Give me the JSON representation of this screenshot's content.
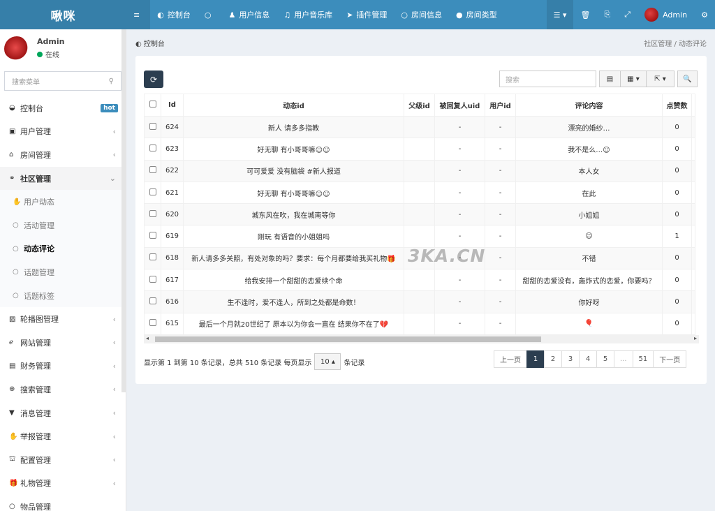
{
  "header": {
    "logo": "啾咪",
    "nav": [
      {
        "icon": "≡",
        "label": ""
      },
      {
        "icon": "◐",
        "label": "控制台"
      },
      {
        "icon": "○",
        "label": ""
      },
      {
        "icon": "♟",
        "label": "用户信息"
      },
      {
        "icon": "♫",
        "label": "用户音乐库"
      },
      {
        "icon": "➤",
        "label": "插件管理"
      },
      {
        "icon": "○",
        "label": "房间信息"
      },
      {
        "icon": "●",
        "label": "房间类型"
      }
    ],
    "right": [
      {
        "icon": "☰ ▾",
        "label": ""
      },
      {
        "icon": "🗑",
        "label": ""
      },
      {
        "icon": "⎘",
        "label": ""
      },
      {
        "icon": "⤢",
        "label": ""
      }
    ],
    "user": "Admin",
    "settings_icon": "⚙"
  },
  "sidebar": {
    "user_name": "Admin",
    "status": "在线",
    "search_placeholder": "搜索菜单",
    "items": [
      {
        "icon": "◒",
        "label": "控制台",
        "badge": "hot",
        "type": "top"
      },
      {
        "icon": "▣",
        "label": "用户管理",
        "chevron": "‹",
        "type": "top"
      },
      {
        "icon": "⌂",
        "label": "房间管理",
        "chevron": "‹",
        "type": "top"
      },
      {
        "icon": "⚭",
        "label": "社区管理",
        "chevron": "⌄",
        "type": "open"
      },
      {
        "icon": "✋",
        "label": "用户动态",
        "type": "sub"
      },
      {
        "icon": "○",
        "label": "活动管理",
        "type": "sub"
      },
      {
        "icon": "○",
        "label": "动态评论",
        "type": "sub-active"
      },
      {
        "icon": "○",
        "label": "话题管理",
        "type": "sub"
      },
      {
        "icon": "○",
        "label": "话题标签",
        "type": "sub"
      },
      {
        "icon": "▨",
        "label": "轮播图管理",
        "chevron": "‹",
        "type": "top"
      },
      {
        "icon": "ℯ",
        "label": "网站管理",
        "chevron": "‹",
        "type": "top"
      },
      {
        "icon": "▤",
        "label": "财务管理",
        "chevron": "‹",
        "type": "top"
      },
      {
        "icon": "⊕",
        "label": "搜索管理",
        "chevron": "‹",
        "type": "top"
      },
      {
        "icon": "▼",
        "label": "消息管理",
        "chevron": "‹",
        "type": "top"
      },
      {
        "icon": "✋",
        "label": "举报管理",
        "chevron": "‹",
        "type": "top"
      },
      {
        "icon": "⛫",
        "label": "配置管理",
        "chevron": "‹",
        "type": "top"
      },
      {
        "icon": "🎁",
        "label": "礼物管理",
        "chevron": "‹",
        "type": "top"
      },
      {
        "icon": "○",
        "label": "物品管理",
        "chevron": "",
        "type": "top"
      }
    ]
  },
  "content": {
    "page_title": "控制台",
    "breadcrumb": [
      "社区管理",
      "/",
      "动态评论"
    ],
    "toolbar": {
      "refresh_icon": "⟳",
      "search_placeholder": "搜索",
      "buttons": [
        "▤",
        "▦ ▾",
        "⇱ ▾",
        "🔍"
      ]
    },
    "table": {
      "columns": [
        "Id",
        "动态id",
        "父级id",
        "被回复人uid",
        "用户id",
        "评论内容",
        "点赞数"
      ],
      "rows": [
        [
          "624",
          "新人 请多多指教",
          "",
          "-",
          "-",
          "漂亮的婚纱…",
          "0"
        ],
        [
          "623",
          "好无聊 有小哥哥嘛☺☺",
          "",
          "-",
          "-",
          "我不是么…☺",
          "0"
        ],
        [
          "622",
          "可可爱爱 没有脑袋 #新人报道",
          "",
          "-",
          "-",
          "本人女",
          "0"
        ],
        [
          "621",
          "好无聊 有小哥哥嘛☺☺",
          "",
          "-",
          "-",
          "在此",
          "0"
        ],
        [
          "620",
          "城东风在吹，我在城南等你",
          "",
          "-",
          "-",
          "小姐姐",
          "0"
        ],
        [
          "619",
          "刚玩 有语音的小姐姐吗",
          "",
          "-",
          "-",
          "☺",
          "1"
        ],
        [
          "618",
          "新人请多多关照，有处对象的吗？要求：每个月都要给我买礼物🎁",
          "",
          "-",
          "-",
          "不错",
          "0"
        ],
        [
          "617",
          "给我安排一个甜甜的恋爱续个命",
          "",
          "-",
          "-",
          "甜甜的恋爱没有，轰炸式的恋爱，你要吗？",
          "0"
        ],
        [
          "616",
          "生不逢时，爱不逢人，所到之处都是命数！",
          "",
          "-",
          "-",
          "你好呀",
          "0"
        ],
        [
          "615",
          "最后一个月就20世纪了 原本以为你会一直在 结果你不在了💔",
          "",
          "-",
          "-",
          "🎈",
          "0"
        ]
      ]
    },
    "pagination": {
      "info_before": "显示第 1 到第 10 条记录，总共 510 条记录 每页显示",
      "page_size": "10 ▴",
      "info_after": "条记录",
      "pages": [
        "上一页",
        "1",
        "2",
        "3",
        "4",
        "5",
        "...",
        "51",
        "下一页"
      ]
    },
    "watermark": "3KA.CN"
  }
}
